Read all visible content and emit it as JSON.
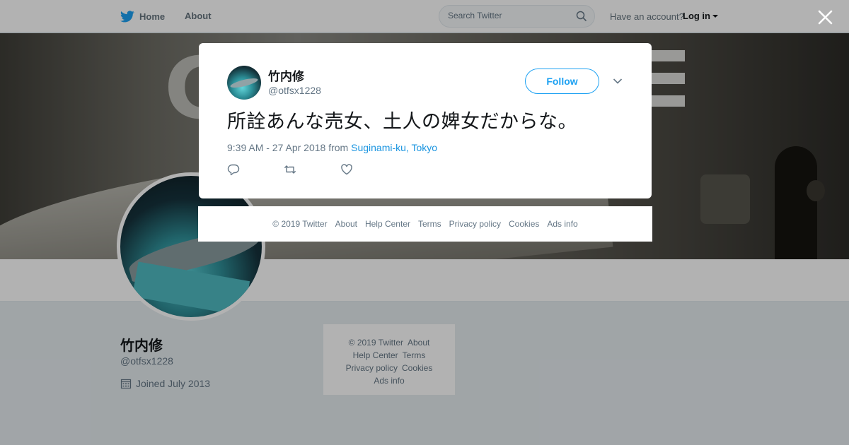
{
  "topbar": {
    "home_label": "Home",
    "about_label": "About",
    "search_placeholder": "Search Twitter",
    "account_prompt": "Have an account?",
    "login_label": "Log in"
  },
  "profile": {
    "name": "竹内修",
    "handle": "@otfsx1228",
    "joined": "Joined July 2013"
  },
  "side_footer": {
    "copyright": "© 2019 Twitter",
    "about": "About",
    "help": "Help Center",
    "terms": "Terms",
    "privacy": "Privacy policy",
    "cookies": "Cookies",
    "ads": "Ads info"
  },
  "tweet": {
    "author_name": "竹内修",
    "author_handle": "@otfsx1228",
    "follow_label": "Follow",
    "text": "所詮あんな売女、土人の婢女だからな。",
    "time": "9:39 AM - 27 Apr 2018",
    "from_word": "from",
    "location": "Suginami-ku, Tokyo"
  },
  "modal_footer": {
    "copyright": "© 2019 Twitter",
    "about": "About",
    "help": "Help Center",
    "terms": "Terms",
    "privacy": "Privacy policy",
    "cookies": "Cookies",
    "ads": "Ads info"
  },
  "colors": {
    "brand_blue": "#1da1f2",
    "link_blue": "#1b95e0",
    "muted": "#657786"
  },
  "icons": [
    "twitter-bird-icon",
    "search-icon",
    "caret-down-icon",
    "close-icon",
    "calendar-icon",
    "chevron-down-icon",
    "reply-icon",
    "retweet-icon",
    "like-icon"
  ]
}
